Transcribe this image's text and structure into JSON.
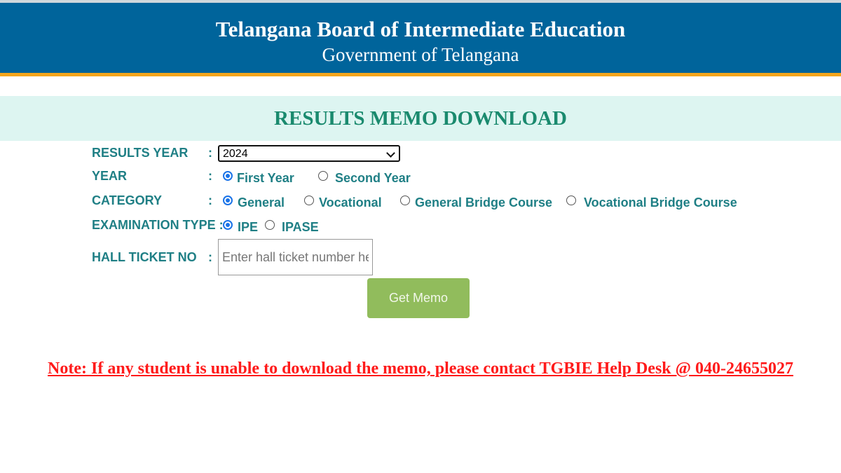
{
  "header": {
    "title": "Telangana Board of Intermediate Education",
    "subtitle": "Government of Telangana"
  },
  "banner": {
    "title": "RESULTS MEMO DOWNLOAD"
  },
  "form": {
    "results_year": {
      "label": "RESULTS YEAR",
      "colon": ":",
      "value": "2024"
    },
    "year": {
      "label": "YEAR",
      "colon": ":",
      "options": [
        "First Year",
        "Second Year"
      ],
      "selected": "First Year"
    },
    "category": {
      "label": "CATEGORY",
      "colon": ":",
      "options": [
        "General",
        "Vocational",
        "General Bridge Course",
        "Vocational Bridge Course"
      ],
      "selected": "General"
    },
    "examination_type": {
      "label": "EXAMINATION TYPE :",
      "options": [
        "IPE",
        "IPASE"
      ],
      "selected": "IPE"
    },
    "hall_ticket": {
      "label": "HALL TICKET NO",
      "colon": ":",
      "value": "",
      "placeholder": "Enter hall ticket number here"
    },
    "submit_label": "Get Memo"
  },
  "note": "Note: If any student is unable to download the memo, please contact TGBIE Help Desk @ 040-24655027",
  "colors": {
    "header_bg": "#00649b",
    "header_accent": "#f4a51c",
    "banner_bg": "#ddf5f1",
    "banner_text": "#1a8a6e",
    "label_text": "#1f7f85",
    "button_bg": "#91bc5c",
    "note_text": "#ff1a1a"
  }
}
